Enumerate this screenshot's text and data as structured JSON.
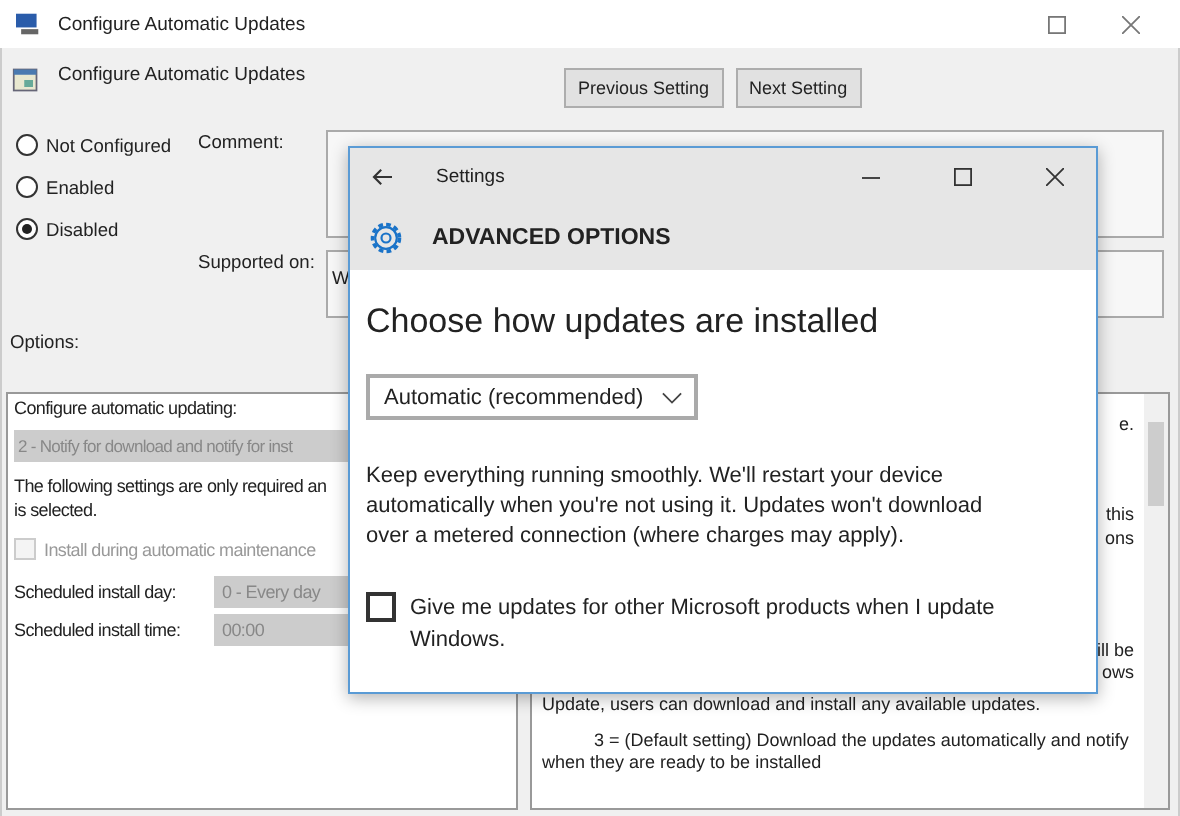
{
  "window": {
    "title": "Configure Automatic Updates"
  },
  "header": {
    "title": "Configure Automatic Updates",
    "buttons": [
      "Previous Setting",
      "Next Setting"
    ]
  },
  "state_options": [
    {
      "label": "Not Configured",
      "selected": false
    },
    {
      "label": "Enabled",
      "selected": false
    },
    {
      "label": "Disabled",
      "selected": true
    }
  ],
  "comment": {
    "label": "Comment:"
  },
  "supported_on": {
    "label": "Supported on:",
    "value": "W"
  },
  "options_label": "Options:",
  "options_panel": {
    "heading": "Configure automatic updating:",
    "dropdown": {
      "value": "2 - Notify for download and notify for inst",
      "disabled": true
    },
    "note_lines": [
      "The following settings are only required an",
      "is selected."
    ],
    "maintenance": {
      "label": "Install during automatic maintenance",
      "checked": false,
      "disabled": true
    },
    "fields": [
      {
        "label": "Scheduled install day:",
        "value": "0 - Every day",
        "disabled": true
      },
      {
        "label": "Scheduled install time:",
        "value": "00:00",
        "disabled": true
      }
    ]
  },
  "help_panel": {
    "fragments": [
      "e.",
      "this",
      "ons",
      "ill be",
      "ows"
    ],
    "lines": [
      "Update, users can download and install any available updates.",
      "3 = (Default setting) Download the updates automatically and notify when they are ready to be installed"
    ]
  },
  "settings_window": {
    "title": "Settings",
    "section": "ADVANCED OPTIONS",
    "heading": "Choose how updates are installed",
    "dropdown": {
      "value": "Automatic (recommended)"
    },
    "description": "Keep everything running smoothly. We'll restart your device automatically when you're not using it. Updates won't download over a metered connection (where charges may apply).",
    "checkbox": {
      "label": "Give me updates for other Microsoft products when I update Windows.",
      "checked": false
    }
  }
}
